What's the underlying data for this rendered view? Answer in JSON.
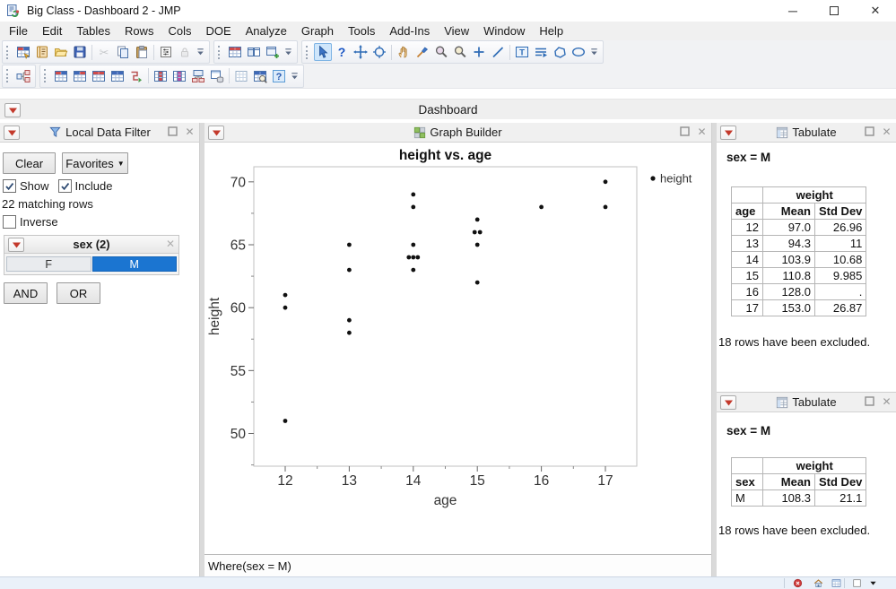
{
  "window": {
    "title": "Big Class - Dashboard 2 - JMP",
    "controls": {
      "minimize": "–",
      "maximize": "▢",
      "close": "✕"
    }
  },
  "menu": {
    "items": [
      "File",
      "Edit",
      "Tables",
      "Rows",
      "Cols",
      "DOE",
      "Analyze",
      "Graph",
      "Tools",
      "Add-Ins",
      "View",
      "Window",
      "Help"
    ]
  },
  "toolbar_main": {
    "groups": [
      {
        "items": [
          {
            "name": "new-data-table-icon",
            "glyph": "tblnew"
          },
          {
            "name": "new-journal-icon",
            "glyph": "journal"
          },
          {
            "name": "open-icon",
            "glyph": "folder"
          },
          {
            "name": "save-icon",
            "glyph": "disk"
          },
          {
            "sep": true
          },
          {
            "name": "cut-icon",
            "glyph": "cut",
            "disabled": true
          },
          {
            "name": "copy-icon",
            "glyph": "copy"
          },
          {
            "name": "paste-icon",
            "glyph": "paste"
          },
          {
            "sep": true
          },
          {
            "name": "data-table-properties-icon",
            "glyph": "propbox"
          },
          {
            "name": "lock-icon",
            "glyph": "lock",
            "disabled": true
          },
          {
            "overflow": true
          }
        ]
      },
      {
        "items": [
          {
            "name": "new-journal-page-icon",
            "glyph": "winred"
          },
          {
            "name": "layout-windows-icon",
            "glyph": "winpair"
          },
          {
            "name": "add-to-journal-icon",
            "glyph": "winplus"
          },
          {
            "overflow": true
          }
        ]
      },
      {
        "items": [
          {
            "name": "arrow-tool-icon",
            "glyph": "cursor",
            "selected": true
          },
          {
            "name": "help-tool-icon",
            "glyph": "qmark"
          },
          {
            "name": "crosshair-tool-icon",
            "glyph": "move"
          },
          {
            "name": "selection-tool-icon",
            "glyph": "target"
          },
          {
            "sep": true
          },
          {
            "name": "grabber-tool-icon",
            "glyph": "hand"
          },
          {
            "name": "brush-tool-icon",
            "glyph": "brush"
          },
          {
            "name": "lasso-tool-icon",
            "glyph": "zoomp"
          },
          {
            "name": "magnifier-tool-icon",
            "glyph": "zoomq"
          },
          {
            "name": "annotate-plus-icon",
            "glyph": "plus"
          },
          {
            "name": "line-annotation-icon",
            "glyph": "slash"
          },
          {
            "sep": true
          },
          {
            "name": "text-annotation-icon",
            "glyph": "tbox"
          },
          {
            "name": "flow-arrow-icon",
            "glyph": "flows"
          },
          {
            "name": "polygon-tool-icon",
            "glyph": "poly"
          },
          {
            "name": "oval-tool-icon",
            "glyph": "oval"
          },
          {
            "overflow": true
          }
        ]
      }
    ]
  },
  "toolbar_tables": {
    "groups": [
      {
        "items": [
          {
            "name": "table-tree-icon",
            "glyph": "treetbl"
          }
        ]
      },
      {
        "items": [
          {
            "name": "stack-tables-icon",
            "glyph": "tblrb"
          },
          {
            "name": "split-tables-icon",
            "glyph": "tblbr"
          },
          {
            "name": "join-tables-icon",
            "glyph": "tblrr"
          },
          {
            "name": "update-table-icon",
            "glyph": "tblbb"
          },
          {
            "name": "transpose-table-icon",
            "glyph": "zig"
          },
          {
            "sep": true
          },
          {
            "name": "concatenate-tables-icon",
            "glyph": "tblh1"
          },
          {
            "name": "merge-tables-icon",
            "glyph": "tblh2"
          },
          {
            "name": "summary-table-icon",
            "glyph": "tblsum"
          },
          {
            "name": "query-builder-icon",
            "glyph": "dbwin"
          },
          {
            "sep": true
          },
          {
            "name": "grid-icon",
            "glyph": "gridpale"
          },
          {
            "name": "table-search-icon",
            "glyph": "tblsearch"
          },
          {
            "name": "help-window-icon",
            "glyph": "qbox"
          },
          {
            "overflow": true
          }
        ]
      }
    ]
  },
  "dashboard": {
    "title": "Dashboard"
  },
  "filter_panel": {
    "title": "Local Data Filter",
    "clear_label": "Clear",
    "favorites_label": "Favorites",
    "favorites_arrow": "▼",
    "show_label": "Show",
    "include_label": "Include",
    "show_checked": true,
    "include_checked": true,
    "matching_text": "22 matching rows",
    "inverse_label": "Inverse",
    "inverse_checked": false,
    "and_label": "AND",
    "or_label": "OR",
    "filter": {
      "label": "sex (2)",
      "options": [
        {
          "label": "F",
          "selected": false
        },
        {
          "label": "M",
          "selected": true
        }
      ]
    }
  },
  "graph_panel": {
    "title": "Graph Builder",
    "where_label": "Where(sex = M)"
  },
  "chart_data": {
    "type": "scatter",
    "title": "height vs. age",
    "xlabel": "age",
    "ylabel": "height",
    "legend": [
      {
        "label": "height",
        "marker": "dot",
        "color": "#111111"
      }
    ],
    "xticks": [
      12,
      13,
      14,
      15,
      16,
      17
    ],
    "yticks": [
      50,
      55,
      60,
      65,
      70
    ],
    "xlim": [
      11.51,
      17.49
    ],
    "ylim": [
      47.4,
      71.2
    ],
    "x_minor": [
      12.5,
      13.5,
      14.5,
      15.5,
      16.5
    ],
    "y_minor": [
      47.5,
      52.5,
      57.5,
      62.5,
      67.5
    ],
    "grid": false,
    "legend_position": "right",
    "marker": {
      "shape": "circle",
      "size": 2.4,
      "color": "#111111"
    },
    "points": [
      {
        "x": 12,
        "y": 61
      },
      {
        "x": 12,
        "y": 60
      },
      {
        "x": 12,
        "y": 51
      },
      {
        "x": 13,
        "y": 65
      },
      {
        "x": 13,
        "y": 63
      },
      {
        "x": 13,
        "y": 59
      },
      {
        "x": 13,
        "y": 58
      },
      {
        "x": 14,
        "y": 69
      },
      {
        "x": 14,
        "y": 68
      },
      {
        "x": 14,
        "y": 65
      },
      {
        "x": 14,
        "y": 64,
        "dx": -5
      },
      {
        "x": 14,
        "y": 64
      },
      {
        "x": 14,
        "y": 64,
        "dx": 5
      },
      {
        "x": 14,
        "y": 63
      },
      {
        "x": 15,
        "y": 67
      },
      {
        "x": 15,
        "y": 66,
        "dx": -3
      },
      {
        "x": 15,
        "y": 66,
        "dx": 3
      },
      {
        "x": 15,
        "y": 65
      },
      {
        "x": 15,
        "y": 62
      },
      {
        "x": 16,
        "y": 68
      },
      {
        "x": 17,
        "y": 70
      },
      {
        "x": 17,
        "y": 68
      }
    ]
  },
  "tabulate_panels": [
    {
      "title": "Tabulate",
      "group_label": "sex = M",
      "table": {
        "span_header": "weight",
        "columns": [
          "age",
          "Mean",
          "Std Dev"
        ],
        "rows": [
          [
            "12",
            "97.0",
            "26.96"
          ],
          [
            "13",
            "94.3",
            "11"
          ],
          [
            "14",
            "103.9",
            "10.68"
          ],
          [
            "15",
            "110.8",
            "9.985"
          ],
          [
            "16",
            "128.0",
            "."
          ],
          [
            "17",
            "153.0",
            "26.87"
          ]
        ]
      },
      "note": "18 rows have been excluded."
    },
    {
      "title": "Tabulate",
      "group_label": "sex = M",
      "table": {
        "span_header": "weight",
        "columns": [
          "sex",
          "Mean",
          "Std Dev"
        ],
        "rows": [
          [
            "M",
            "108.3",
            "21.1"
          ]
        ]
      },
      "note": "18 rows have been excluded."
    }
  ],
  "status_bar": {
    "icons": [
      {
        "name": "error-status-icon",
        "glyph": "err"
      },
      {
        "name": "home-icon",
        "glyph": "house"
      },
      {
        "name": "window-list-icon",
        "glyph": "winlist"
      },
      {
        "name": "status-checkbox-icon",
        "glyph": "sbox"
      },
      {
        "name": "status-menu-icon",
        "glyph": "dtri"
      }
    ]
  },
  "colors": {
    "accent_blue": "#1b75d1",
    "red_triangle": "#c3392b",
    "selection_bg": "#cfe6fb",
    "point_color": "#111111"
  }
}
